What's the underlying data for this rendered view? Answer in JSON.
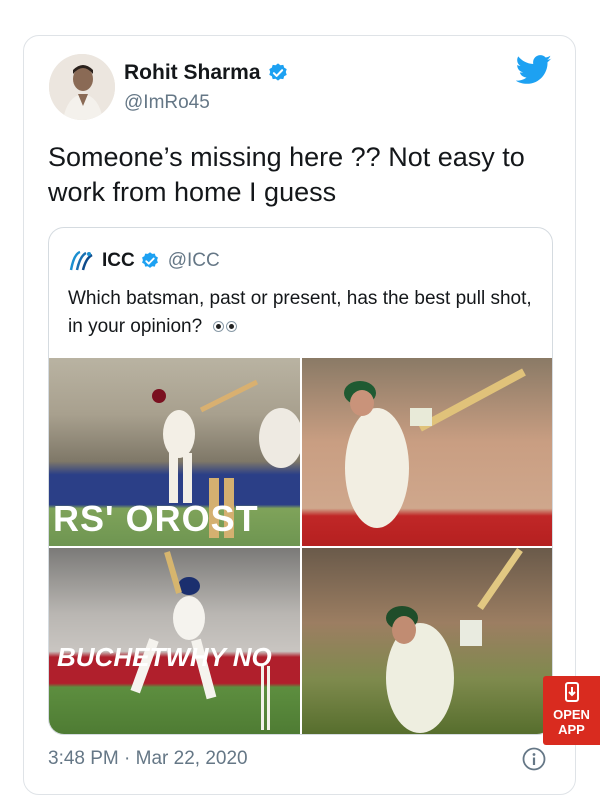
{
  "tweet": {
    "author_name": "Rohit Sharma",
    "author_handle": "@ImRo45",
    "text": "Someone’s missing here ?? Not easy to work from home I guess",
    "timestamp": "3:48 PM · Mar 22, 2020"
  },
  "quoted": {
    "author_name": "ICC",
    "author_handle": "@ICC",
    "text": "Which batsman, past or present, has the best pull shot, in your opinion?",
    "images": [
      {
        "banner": "RS' OROST"
      },
      {
        "banner": ""
      },
      {
        "banner": "BUCHETWHY NO"
      },
      {
        "banner": ""
      }
    ]
  },
  "open_app": {
    "label": "OPEN APP"
  },
  "colors": {
    "twitter_blue": "#1da1f2",
    "open_app_red": "#d92b1f"
  },
  "icons": [
    "verified-icon",
    "twitter-bird-icon",
    "icc-logo-icon",
    "info-icon",
    "phone-icon",
    "eyes-emoji-icon"
  ]
}
